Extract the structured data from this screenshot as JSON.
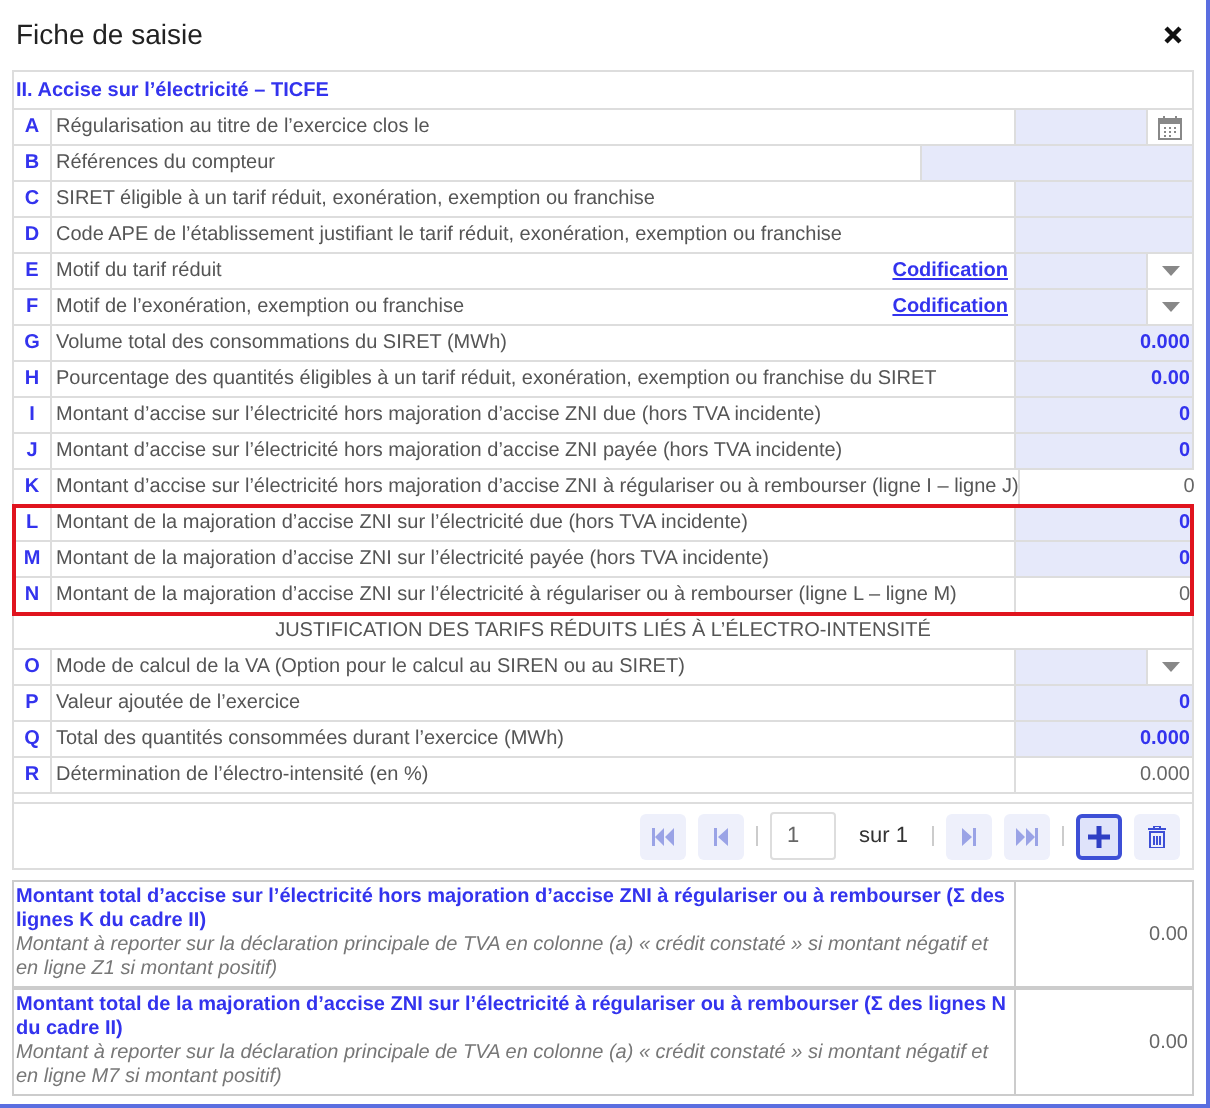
{
  "window": {
    "title": "Fiche de saisie"
  },
  "section": {
    "title": "II. Accise sur l’électricité – TICFE"
  },
  "blocks": [
    {
      "kind": "rows",
      "highlighted": false,
      "rows": [
        {
          "letter": "A",
          "label": "Régularisation au titre de l’exercice clos le",
          "kind": "date",
          "editable": true
        },
        {
          "letter": "B",
          "label": "Références du compteur",
          "kind": "wide",
          "editable": true
        },
        {
          "letter": "C",
          "label": "SIRET éligible à un tarif réduit, exonération, exemption ou franchise",
          "kind": "text",
          "editable": true
        },
        {
          "letter": "D",
          "label": "Code APE de l’établissement justifiant le tarif réduit, exonération, exemption ou franchise",
          "kind": "text",
          "editable": true
        },
        {
          "letter": "E",
          "label": "Motif du tarif réduit",
          "kind": "select",
          "editable": true,
          "link": "Codification"
        },
        {
          "letter": "F",
          "label": "Motif de l’exonération, exemption ou franchise",
          "kind": "select",
          "editable": true,
          "link": "Codification"
        },
        {
          "letter": "G",
          "label": "Volume total des consommations du SIRET (MWh)",
          "kind": "number",
          "editable": true,
          "value": "0.000"
        },
        {
          "letter": "H",
          "label": "Pourcentage des quantités éligibles à un tarif réduit, exonération, exemption ou franchise du SIRET",
          "kind": "number",
          "editable": true,
          "value": "0.00"
        },
        {
          "letter": "I",
          "label": "Montant d’accise sur l’électricité hors majoration d’accise ZNI due (hors TVA incidente)",
          "kind": "number",
          "editable": true,
          "value": "0"
        },
        {
          "letter": "J",
          "label": "Montant d’accise sur l’électricité hors majoration d’accise ZNI payée (hors TVA incidente)",
          "kind": "number",
          "editable": true,
          "value": "0"
        },
        {
          "letter": "K",
          "label": "Montant d’accise sur l’électricité hors majoration d’accise ZNI à régulariser ou à rembourser (ligne I – ligne J)",
          "kind": "number",
          "editable": false,
          "value": "0"
        }
      ]
    },
    {
      "kind": "rows",
      "highlighted": true,
      "rows": [
        {
          "letter": "L",
          "label": "Montant de la majoration d’accise ZNI sur l’électricité due (hors TVA incidente)",
          "kind": "number",
          "editable": true,
          "value": "0"
        },
        {
          "letter": "M",
          "label": "Montant de la majoration d’accise ZNI sur l’électricité payée (hors TVA incidente)",
          "kind": "number",
          "editable": true,
          "value": "0"
        },
        {
          "letter": "N",
          "label": "Montant de la majoration d’accise ZNI sur l’électricité à régulariser ou à rembourser (ligne L – ligne M)",
          "kind": "number",
          "editable": false,
          "value": "0"
        }
      ]
    },
    {
      "kind": "heading",
      "text": "JUSTIFICATION DES TARIFS RÉDUITS LIÉS À L’ÉLECTRO-INTENSITÉ"
    },
    {
      "kind": "rows",
      "highlighted": false,
      "rows": [
        {
          "letter": "O",
          "label": "Mode de calcul de la VA (Option pour le calcul au SIREN ou au SIRET)",
          "kind": "select",
          "editable": true
        },
        {
          "letter": "P",
          "label": "Valeur ajoutée de l’exercice",
          "kind": "number",
          "editable": true,
          "value": "0"
        },
        {
          "letter": "Q",
          "label": "Total des quantités consommées durant l’exercice (MWh)",
          "kind": "number",
          "editable": true,
          "value": "0.000"
        },
        {
          "letter": "R",
          "label": "Détermination de l’électro-intensité (en %)",
          "kind": "number",
          "editable": false,
          "value": "0.000"
        }
      ]
    }
  ],
  "pager": {
    "page": "1",
    "of": "sur 1",
    "add_selected": true
  },
  "totals": [
    {
      "title": "Montant total d’accise sur l’électricité hors majoration d’accise ZNI à régulariser ou à rembourser (Σ des lignes K du cadre II)",
      "note": "Montant à reporter sur la déclaration principale de TVA en colonne (a) « crédit constaté » si montant négatif et en ligne Z1 si montant positif)",
      "value": "0.00"
    },
    {
      "title": "Montant total de la majoration d’accise ZNI sur l’électricité à régulariser ou à rembourser (Σ des lignes N du cadre II)",
      "note": "Montant à reporter sur la déclaration principale de TVA en colonne (a) « crédit constaté » si montant négatif et en ligne M7 si montant positif)",
      "value": "0.00"
    }
  ]
}
